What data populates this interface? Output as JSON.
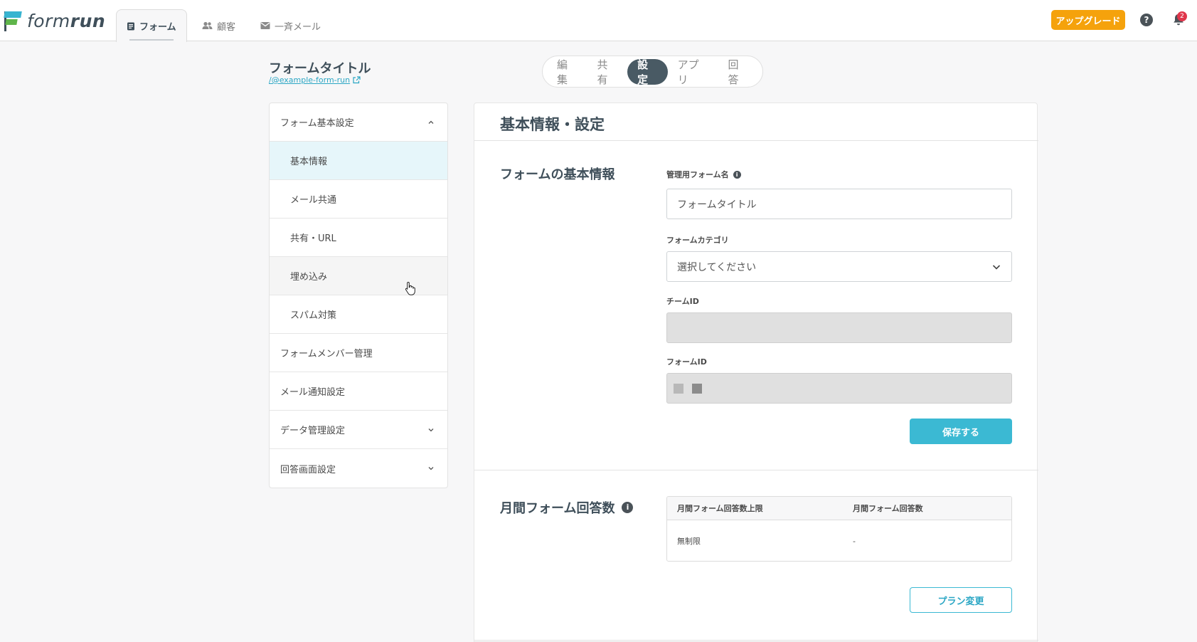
{
  "header": {
    "logo_text_a": "form",
    "logo_text_b": "run",
    "tabs": [
      {
        "label": "フォーム",
        "icon": "form-doc-icon",
        "active": true
      },
      {
        "label": "顧客",
        "icon": "users-icon",
        "active": false
      },
      {
        "label": "一斉メール",
        "icon": "mail-icon",
        "active": false
      }
    ],
    "upgrade_label": "アップグレード",
    "help_glyph": "?",
    "notification_count": "2"
  },
  "form": {
    "title": "フォームタイトル",
    "link": "/@example-form-run"
  },
  "segmented": {
    "items": [
      "編集",
      "共有",
      "設定",
      "アプリ",
      "回答"
    ],
    "active": "設定"
  },
  "sidebar": {
    "items": [
      {
        "label": "フォーム基本設定",
        "chevron": "up"
      },
      {
        "label": "基本情報",
        "sub": true,
        "selected": true
      },
      {
        "label": "メール共通",
        "sub": true
      },
      {
        "label": "共有・URL",
        "sub": true
      },
      {
        "label": "埋め込み",
        "sub": true,
        "hover": true
      },
      {
        "label": "スパム対策",
        "sub": true
      },
      {
        "label": "フォームメンバー管理"
      },
      {
        "label": "メール通知設定"
      },
      {
        "label": "データ管理設定",
        "chevron": "down"
      },
      {
        "label": "回答画面設定",
        "chevron": "down"
      }
    ]
  },
  "main": {
    "title": "基本情報・設定",
    "basic_section": {
      "title": "フォームの基本情報",
      "admin_name_label": "管理用フォーム名",
      "admin_name_value": "フォームタイトル",
      "category_label": "フォームカテゴリ",
      "category_value": "選択してください",
      "team_id_label": "チームID",
      "team_id_value": "",
      "form_id_label": "フォームID",
      "save_label": "保存する"
    },
    "quota_section": {
      "title": "月間フォーム回答数",
      "columns": [
        "月間フォーム回答数上限",
        "月間フォーム回答数"
      ],
      "row": [
        "無制限",
        "-"
      ],
      "plan_label": "プラン変更"
    }
  },
  "colors": {
    "accent": "#3bb9d3",
    "upgrade": "#f5a20c",
    "badge": "#e0364b",
    "dark": "#495a64"
  }
}
